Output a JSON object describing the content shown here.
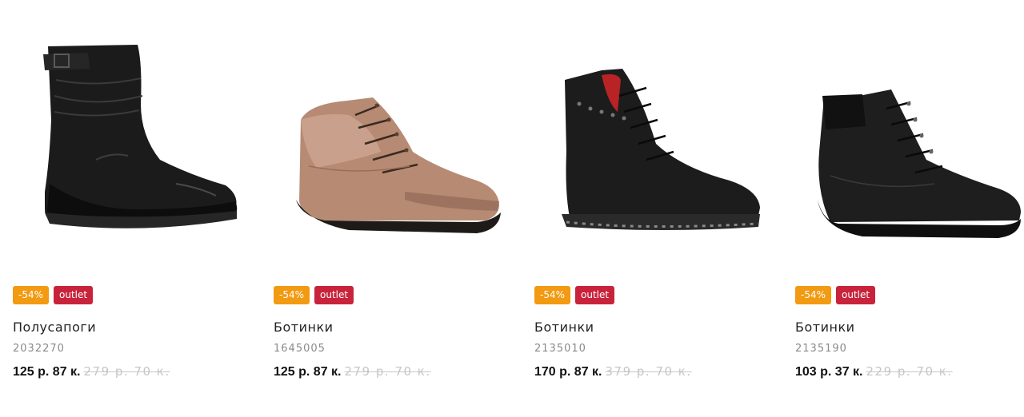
{
  "products": [
    {
      "badge_discount": "-54%",
      "badge_outlet": "outlet",
      "name": "Полусапоги",
      "sku": "2032270",
      "price": "125 р. 87 к.",
      "old_price": "279 р. 70 к.",
      "image": "black-leather-mid-calf-boot"
    },
    {
      "badge_discount": "-54%",
      "badge_outlet": "outlet",
      "name": "Ботинки",
      "sku": "1645005",
      "price": "125 р. 87 к.",
      "old_price": "279 р. 70 к.",
      "image": "beige-leather-lace-up-boot"
    },
    {
      "badge_discount": "-54%",
      "badge_outlet": "outlet",
      "name": "Ботинки",
      "sku": "2135010",
      "price": "170 р. 87 к.",
      "old_price": "379 р. 70 к.",
      "image": "black-lace-up-ankle-boot"
    },
    {
      "badge_discount": "-54%",
      "badge_outlet": "outlet",
      "name": "Ботинки",
      "sku": "2135190",
      "price": "103 р. 37 к.",
      "old_price": "229 р. 70 к.",
      "image": "black-wedge-lace-up-boot"
    }
  ],
  "colors": {
    "discount_badge": "#f29a12",
    "outlet_badge": "#c8233b",
    "old_price": "#c6c6c6",
    "sku": "#8a8a8a"
  }
}
